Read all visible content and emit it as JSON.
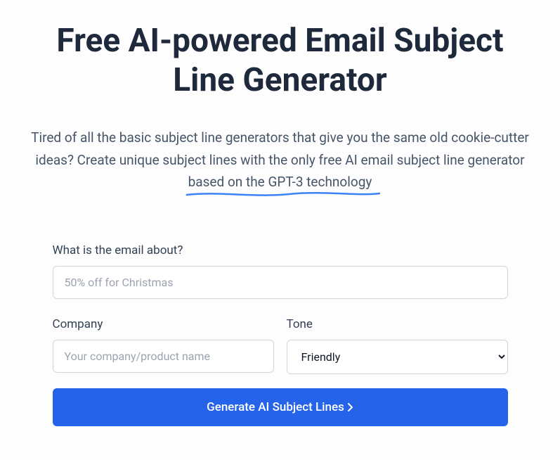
{
  "header": {
    "title": "Free AI-powered Email Subject Line Generator",
    "subtitle_prefix": "Tired of all the basic subject line generators that give you the same old cookie-cutter ideas? Create unique subject lines with the only free AI email subject line generator ",
    "subtitle_underlined": "based on the GPT-3 technology"
  },
  "form": {
    "about": {
      "label": "What is the email about?",
      "placeholder": "50% off for Christmas",
      "value": ""
    },
    "company": {
      "label": "Company",
      "placeholder": "Your company/product name",
      "value": ""
    },
    "tone": {
      "label": "Tone",
      "selected": "Friendly"
    },
    "submit_label": "Generate AI Subject Lines"
  },
  "colors": {
    "accent": "#2563eb",
    "underline": "#3b82f6"
  }
}
